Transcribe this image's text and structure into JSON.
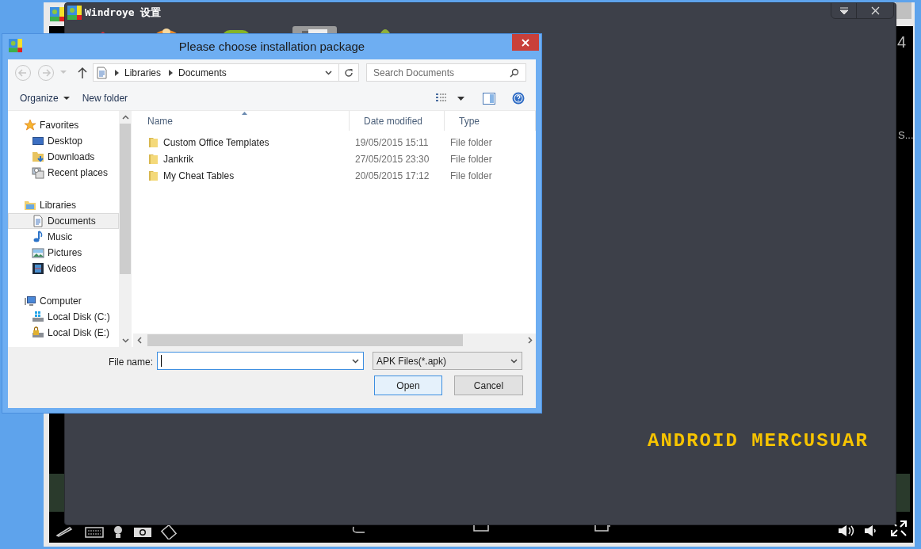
{
  "emulator": {
    "edge_texts": [
      "4",
      "S..."
    ]
  },
  "settings_window": {
    "title": "Windroye 设置",
    "banner": "ANDROID MERCUSUAR"
  },
  "dialog": {
    "title": "Please choose installation package",
    "breadcrumb": [
      "Libraries",
      "Documents"
    ],
    "search": {
      "placeholder": "Search Documents"
    },
    "toolbar": [
      {
        "label": "Organize",
        "menu": true
      },
      {
        "label": "New folder",
        "menu": false
      }
    ],
    "nav": [
      {
        "label": "Favorites",
        "kind": "star",
        "selected": false,
        "children": [
          {
            "label": "Desktop",
            "kind": "desktop",
            "selected": false
          },
          {
            "label": "Downloads",
            "kind": "downloads",
            "selected": false
          },
          {
            "label": "Recent places",
            "kind": "recent",
            "selected": false
          }
        ]
      },
      {
        "label": "Libraries",
        "kind": "library",
        "selected": false,
        "children": [
          {
            "label": "Documents",
            "kind": "document",
            "selected": true
          },
          {
            "label": "Music",
            "kind": "music",
            "selected": false
          },
          {
            "label": "Pictures",
            "kind": "pictures",
            "selected": false
          },
          {
            "label": "Videos",
            "kind": "videos",
            "selected": false
          }
        ]
      },
      {
        "label": "Computer",
        "kind": "computer",
        "selected": false,
        "children": [
          {
            "label": "Local Disk (C:)",
            "kind": "disk",
            "selected": false
          },
          {
            "label": "Local Disk (E:)",
            "kind": "locked-disk",
            "selected": false
          }
        ]
      }
    ],
    "columns": [
      "Name",
      "Date modified",
      "Type"
    ],
    "rows": [
      {
        "name": "Custom Office Templates",
        "date": "19/05/2015 15:11",
        "type": "File folder"
      },
      {
        "name": "Jankrik",
        "date": "27/05/2015 23:30",
        "type": "File folder"
      },
      {
        "name": "My Cheat Tables",
        "date": "20/05/2015 17:12",
        "type": "File folder"
      }
    ],
    "file_name_label": "File name:",
    "filter": "APK Files(*.apk)",
    "buttons": [
      "Open",
      "Cancel"
    ]
  }
}
